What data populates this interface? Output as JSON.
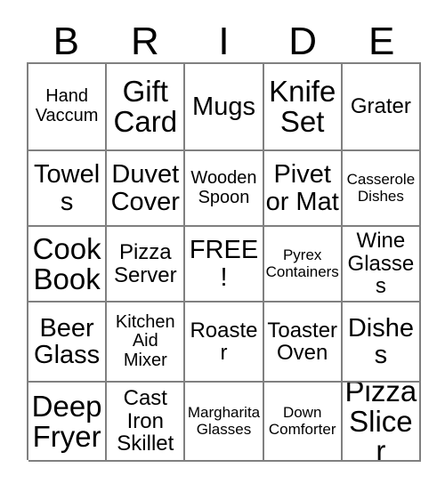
{
  "card": {
    "title_letters": [
      "B",
      "R",
      "I",
      "D",
      "E"
    ],
    "grid": {
      "rows": [
        [
          {
            "text": "Hand Vaccum",
            "size": "fs-sm"
          },
          {
            "text": "Gift Card",
            "size": "fs-xl"
          },
          {
            "text": "Mugs",
            "size": "fs-lg"
          },
          {
            "text": "Knife Set",
            "size": "fs-xl"
          },
          {
            "text": "Grater",
            "size": "fs-md"
          }
        ],
        [
          {
            "text": "Towels",
            "size": "fs-lg"
          },
          {
            "text": "Duvet Cover",
            "size": "fs-lg"
          },
          {
            "text": "Wooden Spoon",
            "size": "fs-sm"
          },
          {
            "text": "Pivet or Mat",
            "size": "fs-lg"
          },
          {
            "text": "Casserole Dishes",
            "size": "fs-xs"
          }
        ],
        [
          {
            "text": "Cook Book",
            "size": "fs-xl"
          },
          {
            "text": "Pizza Server",
            "size": "fs-md"
          },
          {
            "text": "FREE!",
            "size": "fs-lg"
          },
          {
            "text": "Pyrex Containers",
            "size": "fs-xs"
          },
          {
            "text": "Wine Glasses",
            "size": "fs-md"
          }
        ],
        [
          {
            "text": "Beer Glass",
            "size": "fs-lg"
          },
          {
            "text": "Kitchen Aid Mixer",
            "size": "fs-sm"
          },
          {
            "text": "Roaster",
            "size": "fs-md"
          },
          {
            "text": "Toaster Oven",
            "size": "fs-md"
          },
          {
            "text": "Dishes",
            "size": "fs-lg"
          }
        ],
        [
          {
            "text": "Deep Fryer",
            "size": "fs-xl"
          },
          {
            "text": "Cast Iron Skillet",
            "size": "fs-md"
          },
          {
            "text": "Margharita Glasses",
            "size": "fs-xs"
          },
          {
            "text": "Down Comforter",
            "size": "fs-xs"
          },
          {
            "text": "Pizza Slicer",
            "size": "fs-xl"
          }
        ]
      ]
    },
    "colors": {
      "background": "#ffffff",
      "text": "#000000",
      "gridline": "#808080"
    }
  }
}
